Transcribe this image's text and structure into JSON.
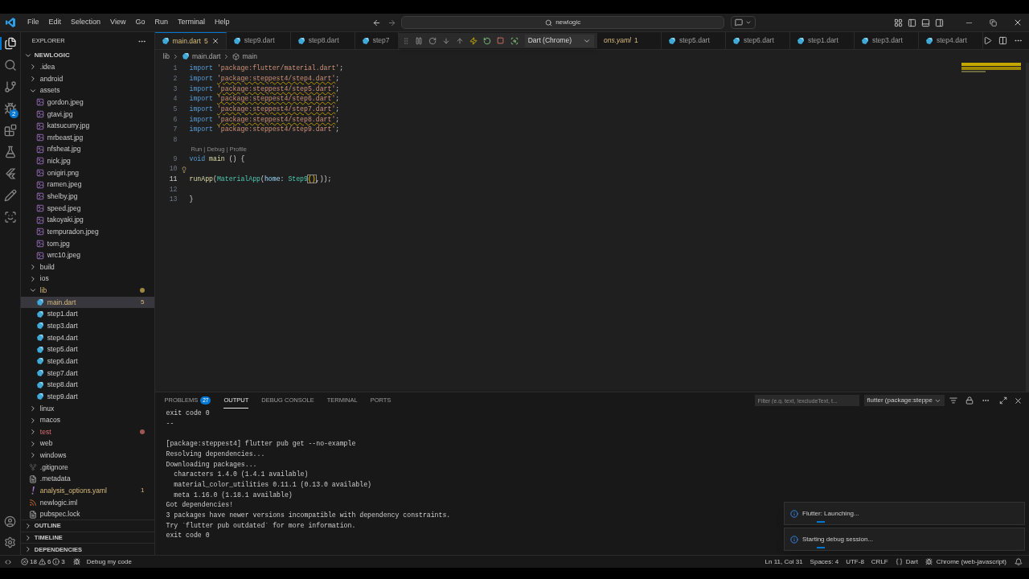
{
  "menu": [
    "File",
    "Edit",
    "Selection",
    "View",
    "Go",
    "Run",
    "Terminal",
    "Help"
  ],
  "command_center": {
    "value": "newlogic"
  },
  "activity_bar": [
    {
      "kind": "files",
      "selected": true
    },
    {
      "kind": "search",
      "selected": false
    },
    {
      "kind": "source-control",
      "selected": false
    },
    {
      "kind": "debug",
      "selected": false,
      "badge": "2"
    },
    {
      "kind": "extensions",
      "selected": false
    },
    {
      "kind": "testing",
      "selected": false
    },
    {
      "kind": "flutter",
      "selected": false
    },
    {
      "kind": "pencil",
      "selected": false
    },
    {
      "kind": "remote",
      "selected": false
    }
  ],
  "sidebar": {
    "title": "EXPLORER",
    "root": "NEWLOGIC",
    "tree": [
      {
        "name": ".idea",
        "kind": "folder",
        "expanded": false
      },
      {
        "name": "android",
        "kind": "folder",
        "expanded": false
      },
      {
        "name": "assets",
        "kind": "folder",
        "expanded": true,
        "children": [
          {
            "name": "gordon.jpeg",
            "kind": "image"
          },
          {
            "name": "gtavi.jpg",
            "kind": "image"
          },
          {
            "name": "katsucurry.jpg",
            "kind": "image"
          },
          {
            "name": "mrbeast.jpg",
            "kind": "image"
          },
          {
            "name": "nfsheat.jpg",
            "kind": "image"
          },
          {
            "name": "nick.jpg",
            "kind": "image"
          },
          {
            "name": "onigiri.png",
            "kind": "image"
          },
          {
            "name": "ramen.jpeg",
            "kind": "image"
          },
          {
            "name": "shelby.jpg",
            "kind": "image"
          },
          {
            "name": "speed.jpeg",
            "kind": "image"
          },
          {
            "name": "takoyaki.jpg",
            "kind": "image"
          },
          {
            "name": "tempuradon.jpeg",
            "kind": "image"
          },
          {
            "name": "tom.jpg",
            "kind": "image"
          },
          {
            "name": "wrc10.jpeg",
            "kind": "image"
          }
        ]
      },
      {
        "name": "build",
        "kind": "folder",
        "expanded": false
      },
      {
        "name": "ios",
        "kind": "folder",
        "expanded": false
      },
      {
        "name": "lib",
        "kind": "folder",
        "expanded": true,
        "warning": true,
        "children": [
          {
            "name": "main.dart",
            "kind": "dart",
            "selected": true,
            "warning": true,
            "badge": "5"
          },
          {
            "name": "step1.dart",
            "kind": "dart",
            "selected": false
          },
          {
            "name": "step3.dart",
            "kind": "dart",
            "selected": false
          },
          {
            "name": "step4.dart",
            "kind": "dart",
            "selected": false
          },
          {
            "name": "step5.dart",
            "kind": "dart",
            "selected": false
          },
          {
            "name": "step6.dart",
            "kind": "dart",
            "selected": false
          },
          {
            "name": "step7.dart",
            "kind": "dart",
            "selected": false
          },
          {
            "name": "step8.dart",
            "kind": "dart",
            "selected": false
          },
          {
            "name": "step9.dart",
            "kind": "dart",
            "selected": false
          }
        ]
      },
      {
        "name": "linux",
        "kind": "folder",
        "expanded": false
      },
      {
        "name": "macos",
        "kind": "folder",
        "expanded": false
      },
      {
        "name": "test",
        "kind": "folder",
        "expanded": false,
        "error": true
      },
      {
        "name": "web",
        "kind": "folder",
        "expanded": false
      },
      {
        "name": "windows",
        "kind": "folder",
        "expanded": false
      },
      {
        "name": ".gitignore",
        "kind": "git"
      },
      {
        "name": ".metadata",
        "kind": "lines"
      },
      {
        "name": "analysis_options.yaml",
        "kind": "yaml",
        "warning": true,
        "badge": "1"
      },
      {
        "name": "newlogic.iml",
        "kind": "xml"
      },
      {
        "name": "pubspec.lock",
        "kind": "lines"
      }
    ],
    "sections": [
      "OUTLINE",
      "TIMELINE",
      "DEPENDENCIES"
    ]
  },
  "tabs": [
    {
      "label": "main.dart",
      "selected": true,
      "badge": "5",
      "kind": "dart"
    },
    {
      "label": "step9.dart",
      "selected": false,
      "kind": "dart"
    },
    {
      "label": "step8.dart",
      "selected": false,
      "kind": "dart"
    },
    {
      "label": "step7",
      "selected": false,
      "kind": "dart"
    },
    {
      "label": "ons.yaml",
      "selected": false,
      "badge": "1",
      "kind": "yaml"
    },
    {
      "label": "step5.dart",
      "selected": false,
      "kind": "dart"
    },
    {
      "label": "step6.dart",
      "selected": false,
      "kind": "dart"
    },
    {
      "label": "step1.dart",
      "selected": false,
      "kind": "dart"
    },
    {
      "label": "step3.dart",
      "selected": false,
      "kind": "dart"
    },
    {
      "label": "step4.dart",
      "selected": false,
      "kind": "dart"
    }
  ],
  "debug_toolbar": {
    "configuration": "Dart (Chrome)"
  },
  "breadcrumb": [
    "lib",
    "main.dart",
    "main"
  ],
  "code": [
    {
      "n": "1",
      "current": false,
      "segments": [
        {
          "t": "import ",
          "kind": "kw"
        },
        {
          "t": "'package:flutter/material.dart'",
          "kind": "str"
        },
        {
          "t": ";",
          "kind": "punct"
        }
      ]
    },
    {
      "n": "2",
      "current": false,
      "segments": [
        {
          "t": "import ",
          "kind": "kw"
        },
        {
          "t": "'package:steppest4/step4.dart'",
          "kind": "str",
          "warn": true
        },
        {
          "t": ";",
          "kind": "punct"
        }
      ]
    },
    {
      "n": "3",
      "current": false,
      "segments": [
        {
          "t": "import ",
          "kind": "kw"
        },
        {
          "t": "'package:steppest4/step5.dart'",
          "kind": "str",
          "warn": true
        },
        {
          "t": ";",
          "kind": "punct"
        }
      ]
    },
    {
      "n": "4",
      "current": false,
      "segments": [
        {
          "t": "import ",
          "kind": "kw"
        },
        {
          "t": "'package:steppest4/step6.dart'",
          "kind": "str",
          "warn": true
        },
        {
          "t": ";",
          "kind": "punct"
        }
      ]
    },
    {
      "n": "5",
      "current": false,
      "segments": [
        {
          "t": "import ",
          "kind": "kw"
        },
        {
          "t": "'package:steppest4/step7.dart'",
          "kind": "str",
          "warn": true
        },
        {
          "t": ";",
          "kind": "punct"
        }
      ]
    },
    {
      "n": "6",
      "current": false,
      "segments": [
        {
          "t": "import ",
          "kind": "kw"
        },
        {
          "t": "'package:steppest4/step8.dart'",
          "kind": "str",
          "warn": true
        },
        {
          "t": ";",
          "kind": "punct"
        }
      ]
    },
    {
      "n": "7",
      "current": false,
      "segments": [
        {
          "t": "import ",
          "kind": "kw"
        },
        {
          "t": "'package:steppest4/step9.dart'",
          "kind": "str"
        },
        {
          "t": ";",
          "kind": "punct"
        }
      ]
    },
    {
      "n": "8",
      "current": false,
      "codelens": "Run | Debug | Profile"
    },
    {
      "n": "9",
      "current": false,
      "segments": [
        {
          "t": "void ",
          "kind": "kw"
        },
        {
          "t": "main",
          "kind": "fn"
        },
        {
          "t": " () {",
          "kind": "punct"
        }
      ]
    },
    {
      "n": "10",
      "current": false,
      "lightbulb": true
    },
    {
      "n": "11",
      "current": true,
      "segments": [
        {
          "t": "runApp",
          "kind": "fn"
        },
        {
          "t": "(",
          "kind": "punct"
        },
        {
          "t": "MaterialApp",
          "kind": "cls"
        },
        {
          "t": "(",
          "kind": "punct"
        },
        {
          "t": "home",
          "kind": "param"
        },
        {
          "t": ": ",
          "kind": "punct"
        },
        {
          "t": "Step9",
          "kind": "cls"
        },
        {
          "t": "()",
          "kind": "bracket"
        },
        {
          "t": ",));",
          "kind": "punct"
        }
      ]
    },
    {
      "n": "12",
      "current": false
    },
    {
      "n": "13",
      "current": false,
      "segments": [
        {
          "t": "}",
          "kind": "punct"
        }
      ]
    }
  ],
  "panel": {
    "tabs": [
      {
        "label": "PROBLEMS",
        "selected": false,
        "badge": "27"
      },
      {
        "label": "OUTPUT",
        "selected": true
      },
      {
        "label": "DEBUG CONSOLE",
        "selected": false
      },
      {
        "label": "TERMINAL",
        "selected": false
      },
      {
        "label": "PORTS",
        "selected": false
      }
    ],
    "filter": {
      "placeholder": "Filter (e.g. text, !excludeText, t..."
    },
    "channel": "flutter (package:steppe",
    "output": [
      [
        "exit code 0",
        "--"
      ],
      [
        "[package:steppest4] flutter pub get --no-example",
        "Resolving dependencies...",
        "Downloading packages...",
        "  characters 1.4.0 (1.4.1 available)",
        "  material_color_utilities 0.11.1 (0.13.0 available)",
        "  meta 1.16.0 (1.18.1 available)",
        "Got dependencies!",
        "3 packages have newer versions incompatible with dependency constraints.",
        "Try `flutter pub outdated` for more information.",
        "exit code 0"
      ]
    ]
  },
  "notifications": [
    "Flutter: Launching...",
    "Starting debug session..."
  ],
  "status_bar": {
    "errors": "18",
    "warnings": "6",
    "infos": "3",
    "debug": "Debug my code",
    "position": "Ln 11, Col 31",
    "spaces": "Spaces: 4",
    "encoding": "UTF-8",
    "eol": "CRLF",
    "language": "Dart",
    "target": "Chrome (web-javascript)"
  }
}
